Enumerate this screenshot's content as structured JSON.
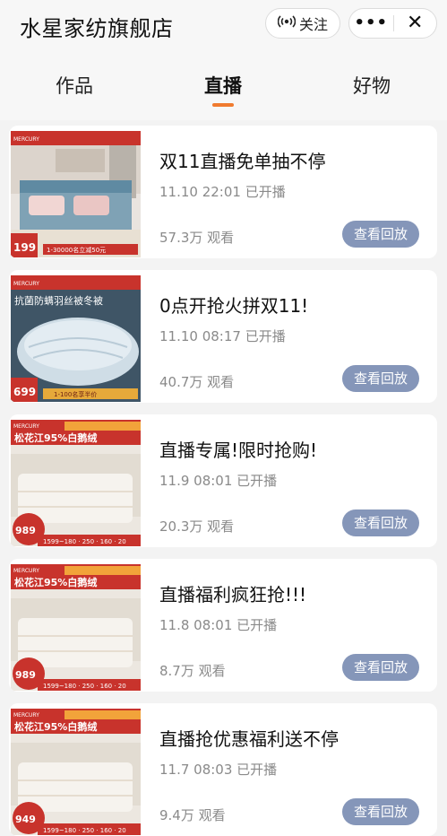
{
  "header": {
    "shop_name": "水星家纺旗舰店",
    "follow_label": "关注",
    "more_label": "•••",
    "close_label": "✕"
  },
  "tabs": [
    {
      "label": "作品",
      "active": false
    },
    {
      "label": "直播",
      "active": true
    },
    {
      "label": "好物",
      "active": false
    }
  ],
  "accent_color": "#f07b2f",
  "button_color": "#8596b9",
  "streams": [
    {
      "title": "双11直播免单抽不停",
      "time": "11.10 22:01 已开播",
      "views": "57.3万 观看",
      "button": "查看回放",
      "thumb": {
        "brand": "MERCURY",
        "price": "199",
        "banner": "1-30000名立减50元",
        "headline": "",
        "style": "bedroom"
      }
    },
    {
      "title": "0点开抢火拼双11!",
      "time": "11.10 08:17 已开播",
      "views": "40.7万 观看",
      "button": "查看回放",
      "thumb": {
        "brand": "MERCURY",
        "price": "699",
        "banner": "1-100名享半价",
        "headline": "抗菌防螨羽丝被冬被",
        "style": "quilt"
      }
    },
    {
      "title": "直播专属!限时抢购!",
      "time": "11.9 08:01 已开播",
      "views": "20.3万 观看",
      "button": "查看回放",
      "thumb": {
        "brand": "MERCURY",
        "price": "989",
        "banner": "1599~180 · 250 · 160 · 20",
        "headline": "松花江95%白鹅绒",
        "style": "down"
      }
    },
    {
      "title": "直播福利疯狂抢!!!",
      "time": "11.8 08:01 已开播",
      "views": "8.7万 观看",
      "button": "查看回放",
      "thumb": {
        "brand": "MERCURY",
        "price": "989",
        "banner": "1599~180 · 250 · 160 · 20",
        "headline": "松花江95%白鹅绒",
        "style": "down"
      }
    },
    {
      "title": "直播抢优惠福利送不停",
      "time": "11.7 08:03 已开播",
      "views": "9.4万 观看",
      "button": "查看回放",
      "thumb": {
        "brand": "MERCURY",
        "price": "949",
        "banner": "1599~180 · 250 · 160 · 20",
        "headline": "松花江95%白鹅绒",
        "style": "down"
      }
    }
  ]
}
